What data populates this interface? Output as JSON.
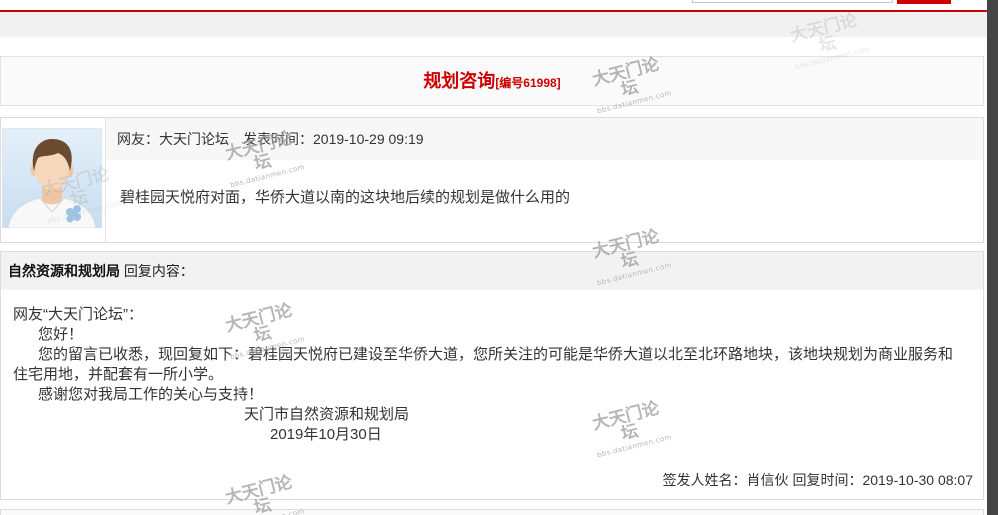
{
  "colors": {
    "accent": "#cc0000",
    "border": "#dcdcdc",
    "panel": "#f2f2f2",
    "text": "#333333",
    "scrollbar": "#454545"
  },
  "watermark": {
    "text": "大天门论坛",
    "url": "bbs.datianmen.com"
  },
  "topic": {
    "title": "规划咨询",
    "number_label": "[编号61998]"
  },
  "post": {
    "avatar_icon": "user-avatar-icon",
    "author_label": "网友：大天门论坛",
    "time_label": "发表时间：2019-10-29 09:19",
    "content": "碧桂园天悦府对面，华侨大道以南的这块地后续的规划是做什么用的"
  },
  "reply": {
    "department": "自然资源和规划局",
    "header_suffix": "回复内容：",
    "greeting": "网友“大天门论坛”：",
    "salutation": "您好！",
    "body": "您的留言已收悉，现回复如下：碧桂园天悦府已建设至华侨大道，您所关注的可能是华侨大道以北至北环路地块，该地块规划为商业服务和住宅用地，并配套有一所小学。",
    "thanks": "感谢您对我局工作的关心与支持！",
    "signature": "天门市自然资源和规划局",
    "date": "2019年10月30日",
    "issuer_label": "签发人姓名：肖信伙",
    "reply_time_label": "回复时间：2019-10-30 08:07"
  }
}
